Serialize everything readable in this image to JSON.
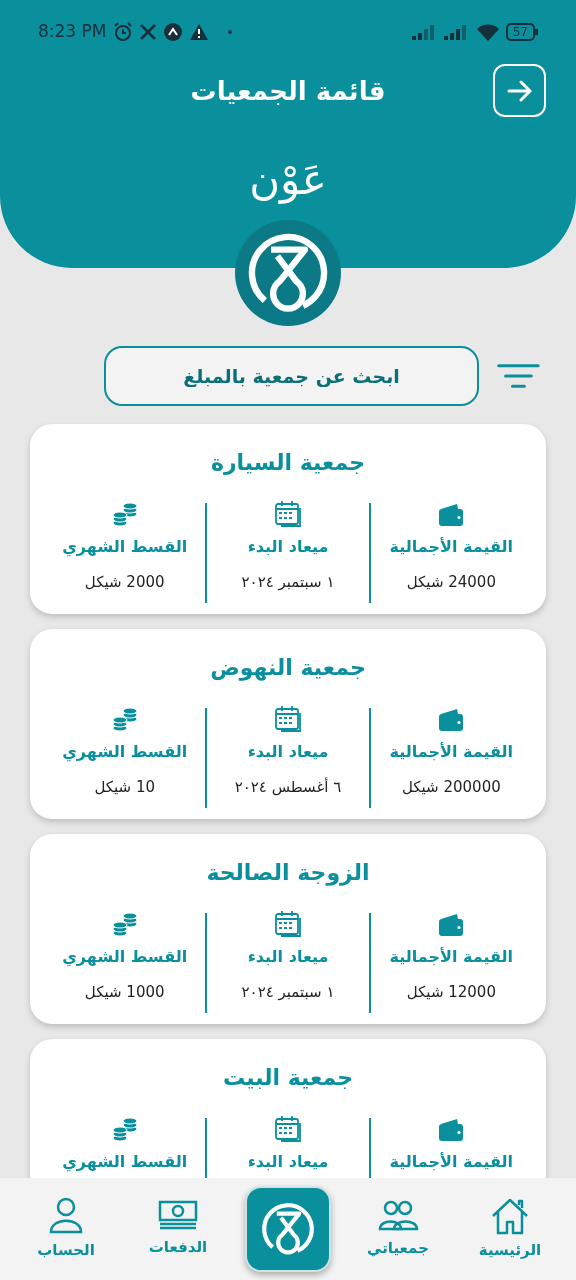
{
  "status_bar": {
    "time": "8:23 PM",
    "battery": "57"
  },
  "header": {
    "title": "قائمة الجمعيات",
    "brand": "عَوْن"
  },
  "search": {
    "placeholder": "ابحث عن جمعية بالمبلغ"
  },
  "cards": [
    {
      "title": "جمعية السيارة",
      "fields": [
        {
          "kind": "wallet",
          "label": "القيمة الأجمالية",
          "value": "24000 شيكل"
        },
        {
          "kind": "calendar",
          "label": "ميعاد البدء",
          "value": "١ سبتمبر ٢٠٢٤"
        },
        {
          "kind": "coins",
          "label": "القسط الشهري",
          "value": "2000 شيكل"
        }
      ]
    },
    {
      "title": "جمعية النهوض",
      "fields": [
        {
          "kind": "wallet",
          "label": "القيمة الأجمالية",
          "value": "200000 شيكل"
        },
        {
          "kind": "calendar",
          "label": "ميعاد البدء",
          "value": "٦ أغسطس ٢٠٢٤"
        },
        {
          "kind": "coins",
          "label": "القسط الشهري",
          "value": "10 شيكل"
        }
      ]
    },
    {
      "title": "الزوجة الصالحة",
      "fields": [
        {
          "kind": "wallet",
          "label": "القيمة الأجمالية",
          "value": "12000 شيكل"
        },
        {
          "kind": "calendar",
          "label": "ميعاد البدء",
          "value": "١ سبتمبر ٢٠٢٤"
        },
        {
          "kind": "coins",
          "label": "القسط الشهري",
          "value": "1000 شيكل"
        }
      ]
    },
    {
      "title": "جمعية البيت",
      "fields": [
        {
          "kind": "wallet",
          "label": "القيمة الأجمالية"
        },
        {
          "kind": "calendar",
          "label": "ميعاد البدء"
        },
        {
          "kind": "coins",
          "label": "القسط الشهري"
        }
      ]
    }
  ],
  "nav": [
    {
      "kind": "home",
      "label": "الرئيسية"
    },
    {
      "kind": "groups",
      "label": "جمعياتي"
    },
    {
      "kind": "center"
    },
    {
      "kind": "money",
      "label": "الدفعات"
    },
    {
      "kind": "account",
      "label": "الحساب"
    }
  ]
}
